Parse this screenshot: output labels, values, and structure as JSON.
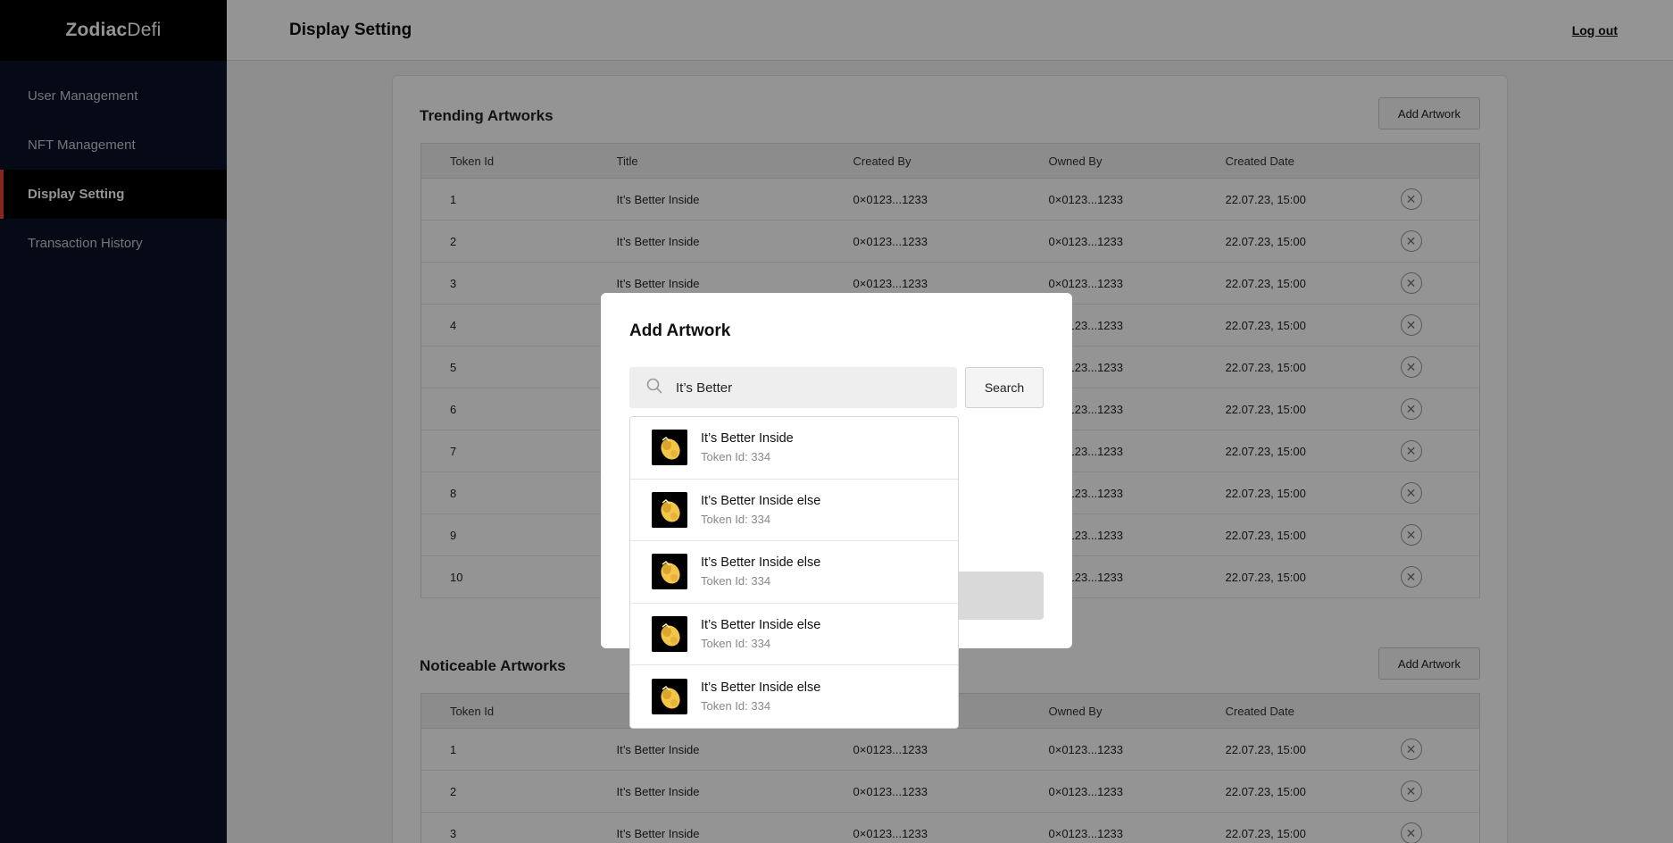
{
  "brand": {
    "bold": "Zodiac",
    "light": "Defi"
  },
  "sidebar": {
    "items": [
      {
        "label": "User Management",
        "active": false
      },
      {
        "label": "NFT Management",
        "active": false
      },
      {
        "label": "Display Setting",
        "active": true
      },
      {
        "label": "Transaction History",
        "active": false
      }
    ]
  },
  "header": {
    "title": "Display Setting",
    "logout": "Log out"
  },
  "trending": {
    "title": "Trending Artworks",
    "add_label": "Add Artwork",
    "columns": [
      "Token Id",
      "Title",
      "Created By",
      "Owned By",
      "Created Date"
    ],
    "rows": [
      [
        "1",
        "It’s Better Inside",
        "0×0123...1233",
        "0×0123...1233",
        "22.07.23, 15:00"
      ],
      [
        "2",
        "It’s Better Inside",
        "0×0123...1233",
        "0×0123...1233",
        "22.07.23, 15:00"
      ],
      [
        "3",
        "It’s Better Inside",
        "0×0123...1233",
        "0×0123...1233",
        "22.07.23, 15:00"
      ],
      [
        "4",
        "",
        "",
        "0×0123...1233",
        "22.07.23, 15:00"
      ],
      [
        "5",
        "",
        "",
        "0×0123...1233",
        "22.07.23, 15:00"
      ],
      [
        "6",
        "",
        "",
        "0×0123...1233",
        "22.07.23, 15:00"
      ],
      [
        "7",
        "",
        "",
        "0×0123...1233",
        "22.07.23, 15:00"
      ],
      [
        "8",
        "",
        "",
        "0×0123...1233",
        "22.07.23, 15:00"
      ],
      [
        "9",
        "",
        "",
        "0×0123...1233",
        "22.07.23, 15:00"
      ],
      [
        "10",
        "",
        "",
        "0×0123...1233",
        "22.07.23, 15:00"
      ]
    ]
  },
  "noticeable": {
    "title": "Noticeable Artworks",
    "add_label": "Add Artwork",
    "columns": [
      "Token Id",
      "",
      "",
      "Owned By",
      "Created Date"
    ],
    "rows": [
      [
        "1",
        "It’s Better Inside",
        "0×0123...1233",
        "0×0123...1233",
        "22.07.23, 15:00"
      ],
      [
        "2",
        "It’s Better Inside",
        "0×0123...1233",
        "0×0123...1233",
        "22.07.23, 15:00"
      ],
      [
        "3",
        "It’s Better Inside",
        "0×0123...1233",
        "0×0123...1233",
        "22.07.23, 15:00"
      ]
    ]
  },
  "modal": {
    "title": "Add Artwork",
    "search_value": "It’s Better",
    "search_button": "Search",
    "results": [
      {
        "title": "It’s Better Inside",
        "token": "Token Id: 334"
      },
      {
        "title": "It’s Better Inside else",
        "token": "Token Id: 334"
      },
      {
        "title": "It’s Better Inside else",
        "token": "Token Id: 334"
      },
      {
        "title": "It’s Better Inside else",
        "token": "Token Id: 334"
      },
      {
        "title": "It’s Better Inside else",
        "token": "Token Id: 334"
      }
    ]
  },
  "icons": {
    "remove": "close-circle-icon",
    "search": "search-icon",
    "thumb": "artwork-thumbnail"
  },
  "colors": {
    "sidebar": "#0c1027",
    "active_accent": "#e0443c",
    "overlay": "rgba(0,0,0,0.42)"
  }
}
